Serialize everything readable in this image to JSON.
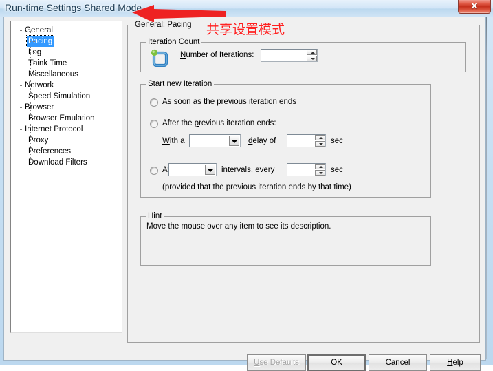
{
  "window": {
    "title": "Run-time Settings Shared Mode",
    "close_label": "✕"
  },
  "annotations": {
    "chinese_note": "共享设置模式",
    "arrow_color": "#ff2020",
    "arrow_name": "red-arrow-pointing-to-title"
  },
  "tree": {
    "nodes": [
      {
        "label": "General",
        "level": 0,
        "selected": false
      },
      {
        "label": "Pacing",
        "level": 1,
        "selected": true
      },
      {
        "label": "Log",
        "level": 1,
        "selected": false
      },
      {
        "label": "Think Time",
        "level": 1,
        "selected": false
      },
      {
        "label": "Miscellaneous",
        "level": 1,
        "selected": false
      },
      {
        "label": "Network",
        "level": 0,
        "selected": false
      },
      {
        "label": "Speed Simulation",
        "level": 1,
        "selected": false
      },
      {
        "label": "Browser",
        "level": 0,
        "selected": false
      },
      {
        "label": "Browser Emulation",
        "level": 1,
        "selected": false
      },
      {
        "label": "Internet Protocol",
        "level": 0,
        "selected": false
      },
      {
        "label": "Proxy",
        "level": 1,
        "selected": false
      },
      {
        "label": "Preferences",
        "level": 1,
        "selected": false
      },
      {
        "label": "Download Filters",
        "level": 1,
        "selected": false
      }
    ]
  },
  "main": {
    "group_title": "General: Pacing",
    "iteration_count": {
      "title": "Iteration Count",
      "number_label_accel": "N",
      "number_label_rest": "umber of Iterations:",
      "number_value": ""
    },
    "start_new_iteration": {
      "title": "Start new Iteration",
      "option1": {
        "pre": "As ",
        "accel": "s",
        "post": "oon as the previous iteration ends",
        "selected": false
      },
      "option2": {
        "pre": "After the ",
        "accel": "p",
        "post": "revious iteration ends:",
        "selected": false
      },
      "option2_row": {
        "with_a_accel": "W",
        "with_a_rest": "ith a",
        "combo_value": "",
        "delay_accel": "d",
        "delay_rest": "elay of",
        "spin_value": "",
        "sec": "sec"
      },
      "option3": {
        "pre": "At",
        "selected": false,
        "combo_value": "",
        "intervals_pre": "intervals, ev",
        "intervals_accel": "e",
        "intervals_post": "ry",
        "spin_value": "",
        "sec": "sec",
        "note": "(provided that the previous iteration ends by that time)"
      }
    },
    "hint": {
      "title": "Hint",
      "text": "Move the mouse over any item to see its description."
    }
  },
  "buttons": {
    "use_defaults_accel": "U",
    "use_defaults_rest": "se Defaults",
    "ok": "OK",
    "cancel": "Cancel",
    "help_accel": "H",
    "help_rest": "elp"
  }
}
